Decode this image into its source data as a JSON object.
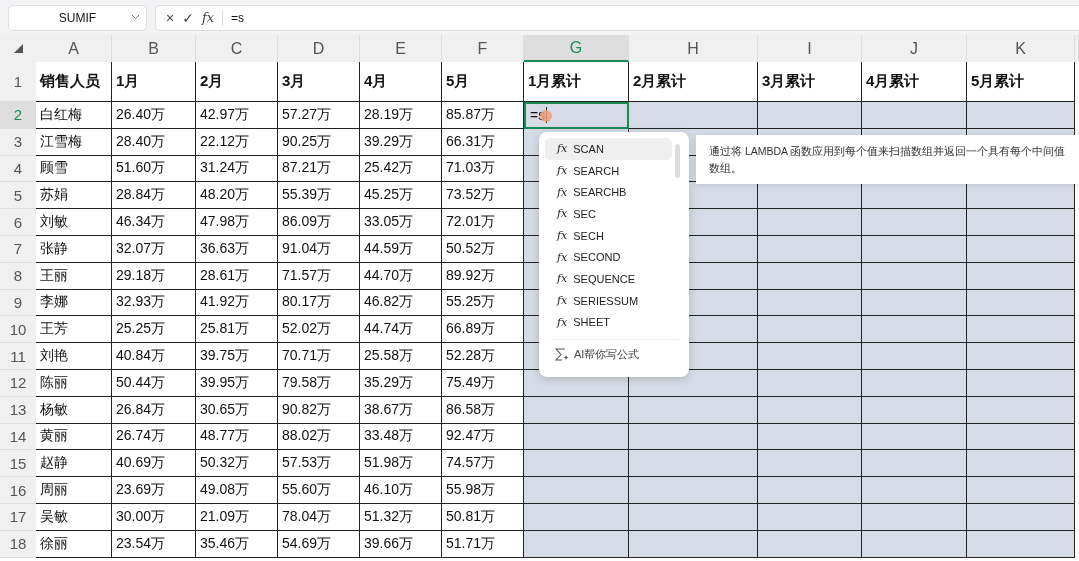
{
  "name_box": {
    "value": "SUMIF"
  },
  "formula_bar": {
    "buttons": [
      "×",
      "✓",
      "fx"
    ],
    "value": "=s"
  },
  "columns": [
    {
      "letter": "A",
      "selected": false,
      "highlighted": false
    },
    {
      "letter": "B",
      "selected": false,
      "highlighted": false
    },
    {
      "letter": "C",
      "selected": false,
      "highlighted": false
    },
    {
      "letter": "D",
      "selected": false,
      "highlighted": false
    },
    {
      "letter": "E",
      "selected": false,
      "highlighted": false
    },
    {
      "letter": "F",
      "selected": false,
      "highlighted": false
    },
    {
      "letter": "G",
      "selected": true,
      "highlighted": true
    },
    {
      "letter": "H",
      "selected": false,
      "highlighted": true
    },
    {
      "letter": "I",
      "selected": false,
      "highlighted": true
    },
    {
      "letter": "J",
      "selected": false,
      "highlighted": true
    },
    {
      "letter": "K",
      "selected": false,
      "highlighted": true
    }
  ],
  "rows": [
    {
      "number": "1",
      "selected": false,
      "header": true,
      "cells": [
        "销售人员",
        "1月",
        "2月",
        "3月",
        "4月",
        "5月",
        "1月累计",
        "2月累计",
        "3月累计",
        "4月累计",
        "5月累计"
      ]
    },
    {
      "number": "2",
      "selected": true,
      "cells": [
        "白红梅",
        "26.40万",
        "42.97万",
        "57.27万",
        "28.19万",
        "85.87万"
      ],
      "active_value": "=s"
    },
    {
      "number": "3",
      "selected": false,
      "cells": [
        "江雪梅",
        "28.40万",
        "22.12万",
        "90.25万",
        "39.29万",
        "66.31万"
      ]
    },
    {
      "number": "4",
      "selected": false,
      "cells": [
        "顾雪",
        "51.60万",
        "31.24万",
        "87.21万",
        "25.42万",
        "71.03万"
      ]
    },
    {
      "number": "5",
      "selected": false,
      "cells": [
        "苏娟",
        "28.84万",
        "48.20万",
        "55.39万",
        "45.25万",
        "73.52万"
      ]
    },
    {
      "number": "6",
      "selected": false,
      "cells": [
        "刘敏",
        "46.34万",
        "47.98万",
        "86.09万",
        "33.05万",
        "72.01万"
      ]
    },
    {
      "number": "7",
      "selected": false,
      "cells": [
        "张静",
        "32.07万",
        "36.63万",
        "91.04万",
        "44.59万",
        "50.52万"
      ]
    },
    {
      "number": "8",
      "selected": false,
      "cells": [
        "王丽",
        "29.18万",
        "28.61万",
        "71.57万",
        "44.70万",
        "89.92万"
      ]
    },
    {
      "number": "9",
      "selected": false,
      "cells": [
        "李娜",
        "32.93万",
        "41.92万",
        "80.17万",
        "46.82万",
        "55.25万"
      ]
    },
    {
      "number": "10",
      "selected": false,
      "cells": [
        "王芳",
        "25.25万",
        "25.81万",
        "52.02万",
        "44.74万",
        "66.89万"
      ]
    },
    {
      "number": "11",
      "selected": false,
      "cells": [
        "刘艳",
        "40.84万",
        "39.75万",
        "70.71万",
        "25.58万",
        "52.28万"
      ]
    },
    {
      "number": "12",
      "selected": false,
      "cells": [
        "陈丽",
        "50.44万",
        "39.95万",
        "79.58万",
        "35.29万",
        "75.49万"
      ]
    },
    {
      "number": "13",
      "selected": false,
      "cells": [
        "杨敏",
        "26.84万",
        "30.65万",
        "90.82万",
        "38.67万",
        "86.58万"
      ]
    },
    {
      "number": "14",
      "selected": false,
      "cells": [
        "黄丽",
        "26.74万",
        "48.77万",
        "88.02万",
        "33.48万",
        "92.47万"
      ]
    },
    {
      "number": "15",
      "selected": false,
      "cells": [
        "赵静",
        "40.69万",
        "50.32万",
        "57.53万",
        "51.98万",
        "74.57万"
      ]
    },
    {
      "number": "16",
      "selected": false,
      "cells": [
        "周丽",
        "23.69万",
        "49.08万",
        "55.60万",
        "46.10万",
        "55.98万"
      ]
    },
    {
      "number": "17",
      "selected": false,
      "cells": [
        "吴敏",
        "30.00万",
        "21.09万",
        "78.04万",
        "51.32万",
        "50.81万"
      ]
    },
    {
      "number": "18",
      "selected": false,
      "cells": [
        "徐丽",
        "23.54万",
        "35.46万",
        "54.69万",
        "39.66万",
        "51.71万"
      ]
    }
  ],
  "autocomplete": {
    "items": [
      {
        "icon": "fx",
        "label": "SCAN",
        "selected": true
      },
      {
        "icon": "fx",
        "label": "SEARCH",
        "selected": false
      },
      {
        "icon": "fx",
        "label": "SEARCHB",
        "selected": false
      },
      {
        "icon": "fx",
        "label": "SEC",
        "selected": false
      },
      {
        "icon": "fx",
        "label": "SECH",
        "selected": false
      },
      {
        "icon": "fx",
        "label": "SECOND",
        "selected": false
      },
      {
        "icon": "fx",
        "label": "SEQUENCE",
        "selected": false
      },
      {
        "icon": "fx",
        "label": "SERIESSUM",
        "selected": false
      },
      {
        "icon": "fx",
        "label": "SHEET",
        "selected": false
      }
    ],
    "ai_action": "AI帮你写公式"
  },
  "tooltip": {
    "lines": [
      "通过将 LAMBDA 函数应用到每个值来扫描数组并返回一个具有每个中间值",
      "数组。"
    ]
  }
}
